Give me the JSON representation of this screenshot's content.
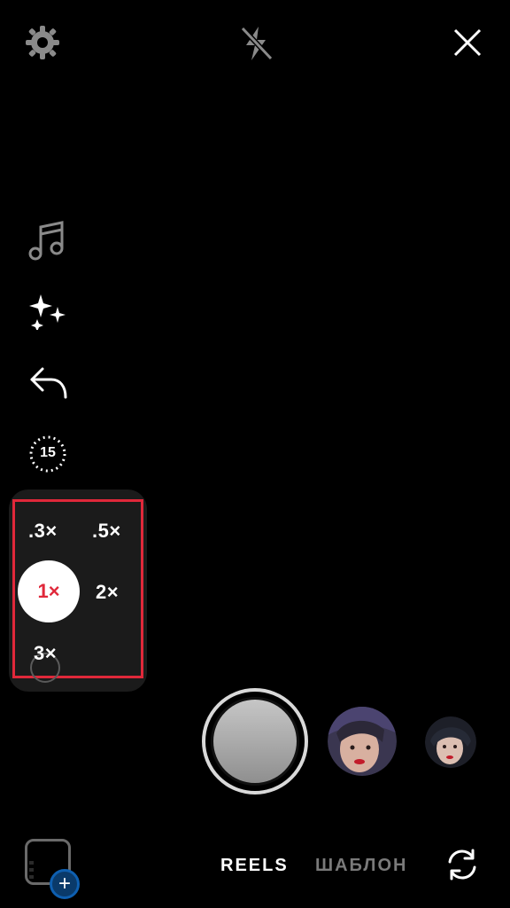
{
  "top_bar": {
    "settings_icon": "gear-icon",
    "flash_icon": "flash-off-icon",
    "close_icon": "close-icon"
  },
  "side_tools": [
    {
      "icon": "music-note-icon"
    },
    {
      "icon": "sparkles-icon"
    },
    {
      "icon": "undo-arrow-icon"
    },
    {
      "icon": "timer-icon",
      "label": "15"
    }
  ],
  "speed_picker": {
    "options": [
      ".3×",
      ".5×",
      "1×",
      "2×",
      "3×"
    ],
    "selected": "1×",
    "highlight_color": "#e0283a"
  },
  "capture": {
    "effects": [
      "effect-avatar-1",
      "effect-avatar-2"
    ]
  },
  "bottom_bar": {
    "modes": [
      "REELS",
      "ШАБЛОН"
    ],
    "active_mode": "REELS",
    "flip_icon": "flip-camera-icon"
  }
}
